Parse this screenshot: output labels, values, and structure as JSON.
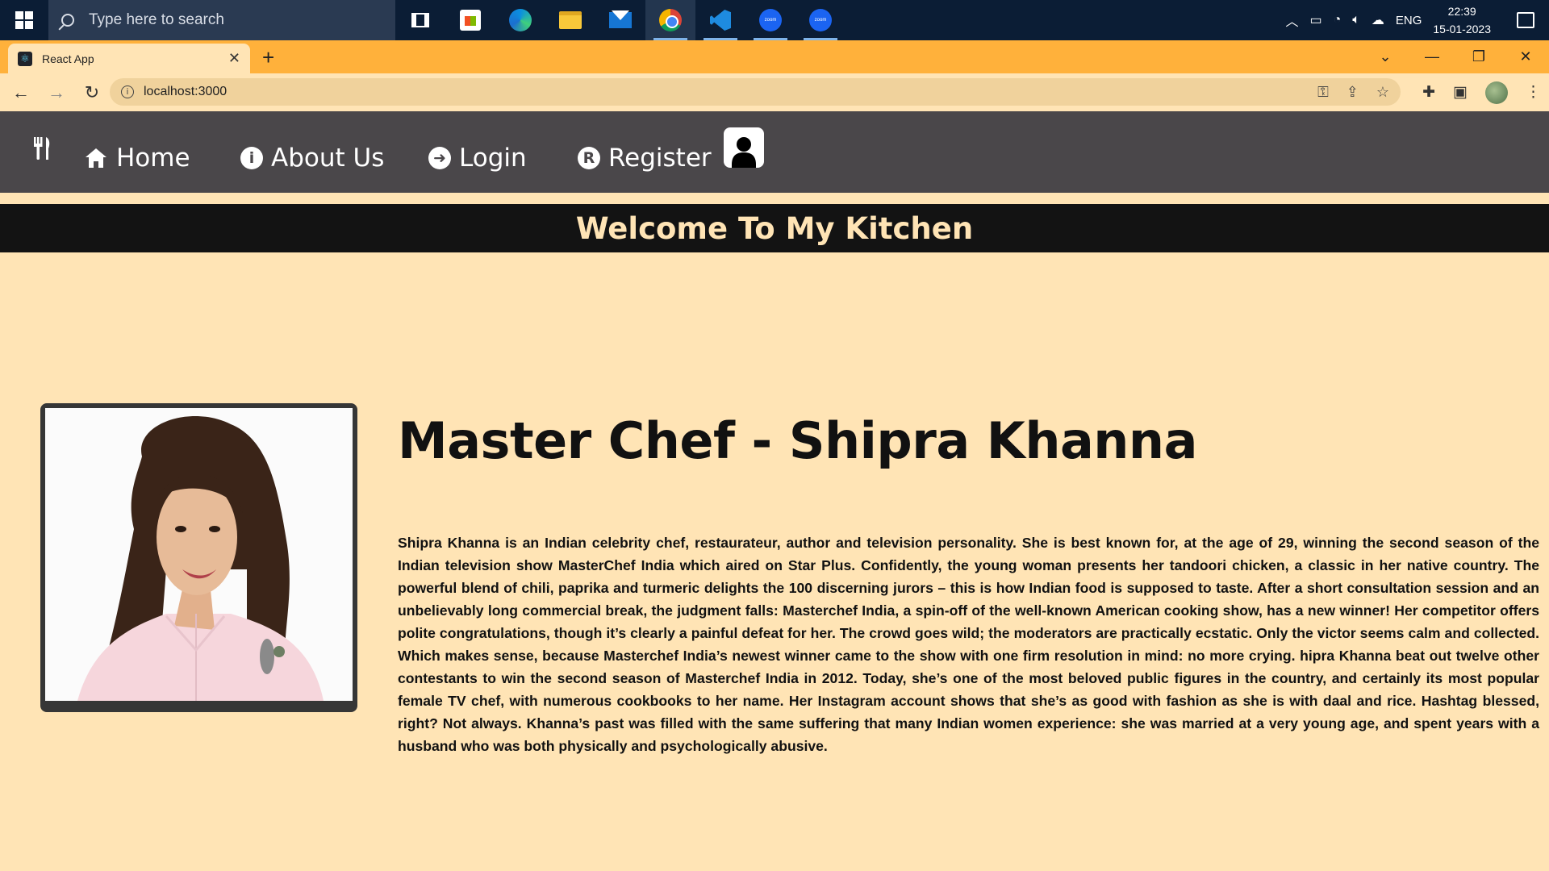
{
  "taskbar": {
    "search_placeholder": "Type here to search",
    "apps": [
      "task-view",
      "microsoft-store",
      "edge",
      "file-explorer",
      "mail",
      "chrome",
      "vscode",
      "zoom",
      "zoom"
    ],
    "language": "ENG",
    "time": "22:39",
    "date": "15-01-2023"
  },
  "browser": {
    "tab_title": "React App",
    "new_tab": "+",
    "url": "localhost:3000"
  },
  "nav": {
    "items": [
      {
        "label": "Home",
        "icon": "home-icon"
      },
      {
        "label": "About Us",
        "icon": "info-icon"
      },
      {
        "label": "Login",
        "icon": "login-arrow-icon"
      },
      {
        "label": "Register",
        "icon": "registered-icon"
      }
    ]
  },
  "banner": {
    "title": "Welcome To My Kitchen"
  },
  "profile": {
    "heading": "Master Chef - Shipra Khanna",
    "bio": "Shipra Khanna is an Indian celebrity chef, restaurateur, author and television personality. She is best known for, at the age of 29, winning the second season of the Indian television show MasterChef India which aired on Star Plus. Confidently, the young woman presents her tandoori chicken, a classic in her native country. The powerful blend of chili, paprika and turmeric delights the 100 discerning jurors – this is how Indian food is supposed to taste. After a short consultation session and an unbelievably long commercial break, the judgment falls: Masterchef India, a spin-off of the well-known American cooking show, has a new winner! Her competitor offers polite congratulations, though it’s clearly a painful defeat for her. The crowd goes wild; the moderators are practically ecstatic. Only the victor seems calm and collected. Which makes sense, because Masterchef India’s newest winner came to the show with one firm resolution in mind: no more crying. hipra Khanna beat out twelve other contestants to win the second season of Masterchef India in 2012. Today, she’s one of the most beloved public figures in the country, and certainly its most popular female TV chef, with numerous cookbooks to her name. Her Instagram account shows that she’s as good with fashion as she is with daal and rice. Hashtag blessed, right? Not always. Khanna’s past was filled with the same suffering that many Indian women experience: she was married at a very young age, and spent years with a husband who was both physically and psychologically abusive."
  },
  "colors": {
    "taskbar": "#0b1d35",
    "tabstrip": "#ffb13b",
    "page_bg": "#ffe4b5",
    "nav_bg": "#4a474a",
    "banner_bg": "#131313",
    "banner_text": "#ffe4b5"
  }
}
